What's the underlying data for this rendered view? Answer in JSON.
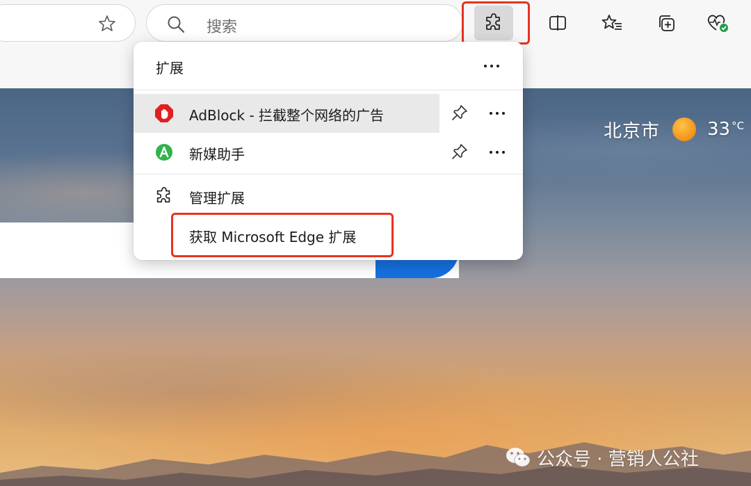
{
  "toolbar": {
    "search_placeholder": "搜索",
    "icons": {
      "favorite_star": "star-icon",
      "search": "search-icon",
      "extensions": "puzzle-icon",
      "split_screen": "split-screen-icon",
      "favorites": "favorites-icon",
      "collections": "collections-icon",
      "browser_essentials": "heart-pulse-icon"
    }
  },
  "extensions_popup": {
    "title": "扩展",
    "items": [
      {
        "label": "AdBlock - 拦截整个网络的广告",
        "icon": "adblock-hand-icon",
        "hovered": true
      },
      {
        "label": "新媒助手",
        "icon": "green-a-icon",
        "hovered": false
      }
    ],
    "manage_label": "管理扩展",
    "get_label": "获取 Microsoft Edge 扩展"
  },
  "weather": {
    "city": "北京市",
    "temperature": "33",
    "unit": "°C"
  },
  "watermark": {
    "text": "公众号 · 营销人公社"
  },
  "colors": {
    "highlight_red": "#e8321e",
    "accent_blue": "#1570e0",
    "adblock_red": "#e02020",
    "helper_green": "#2fb34a"
  }
}
